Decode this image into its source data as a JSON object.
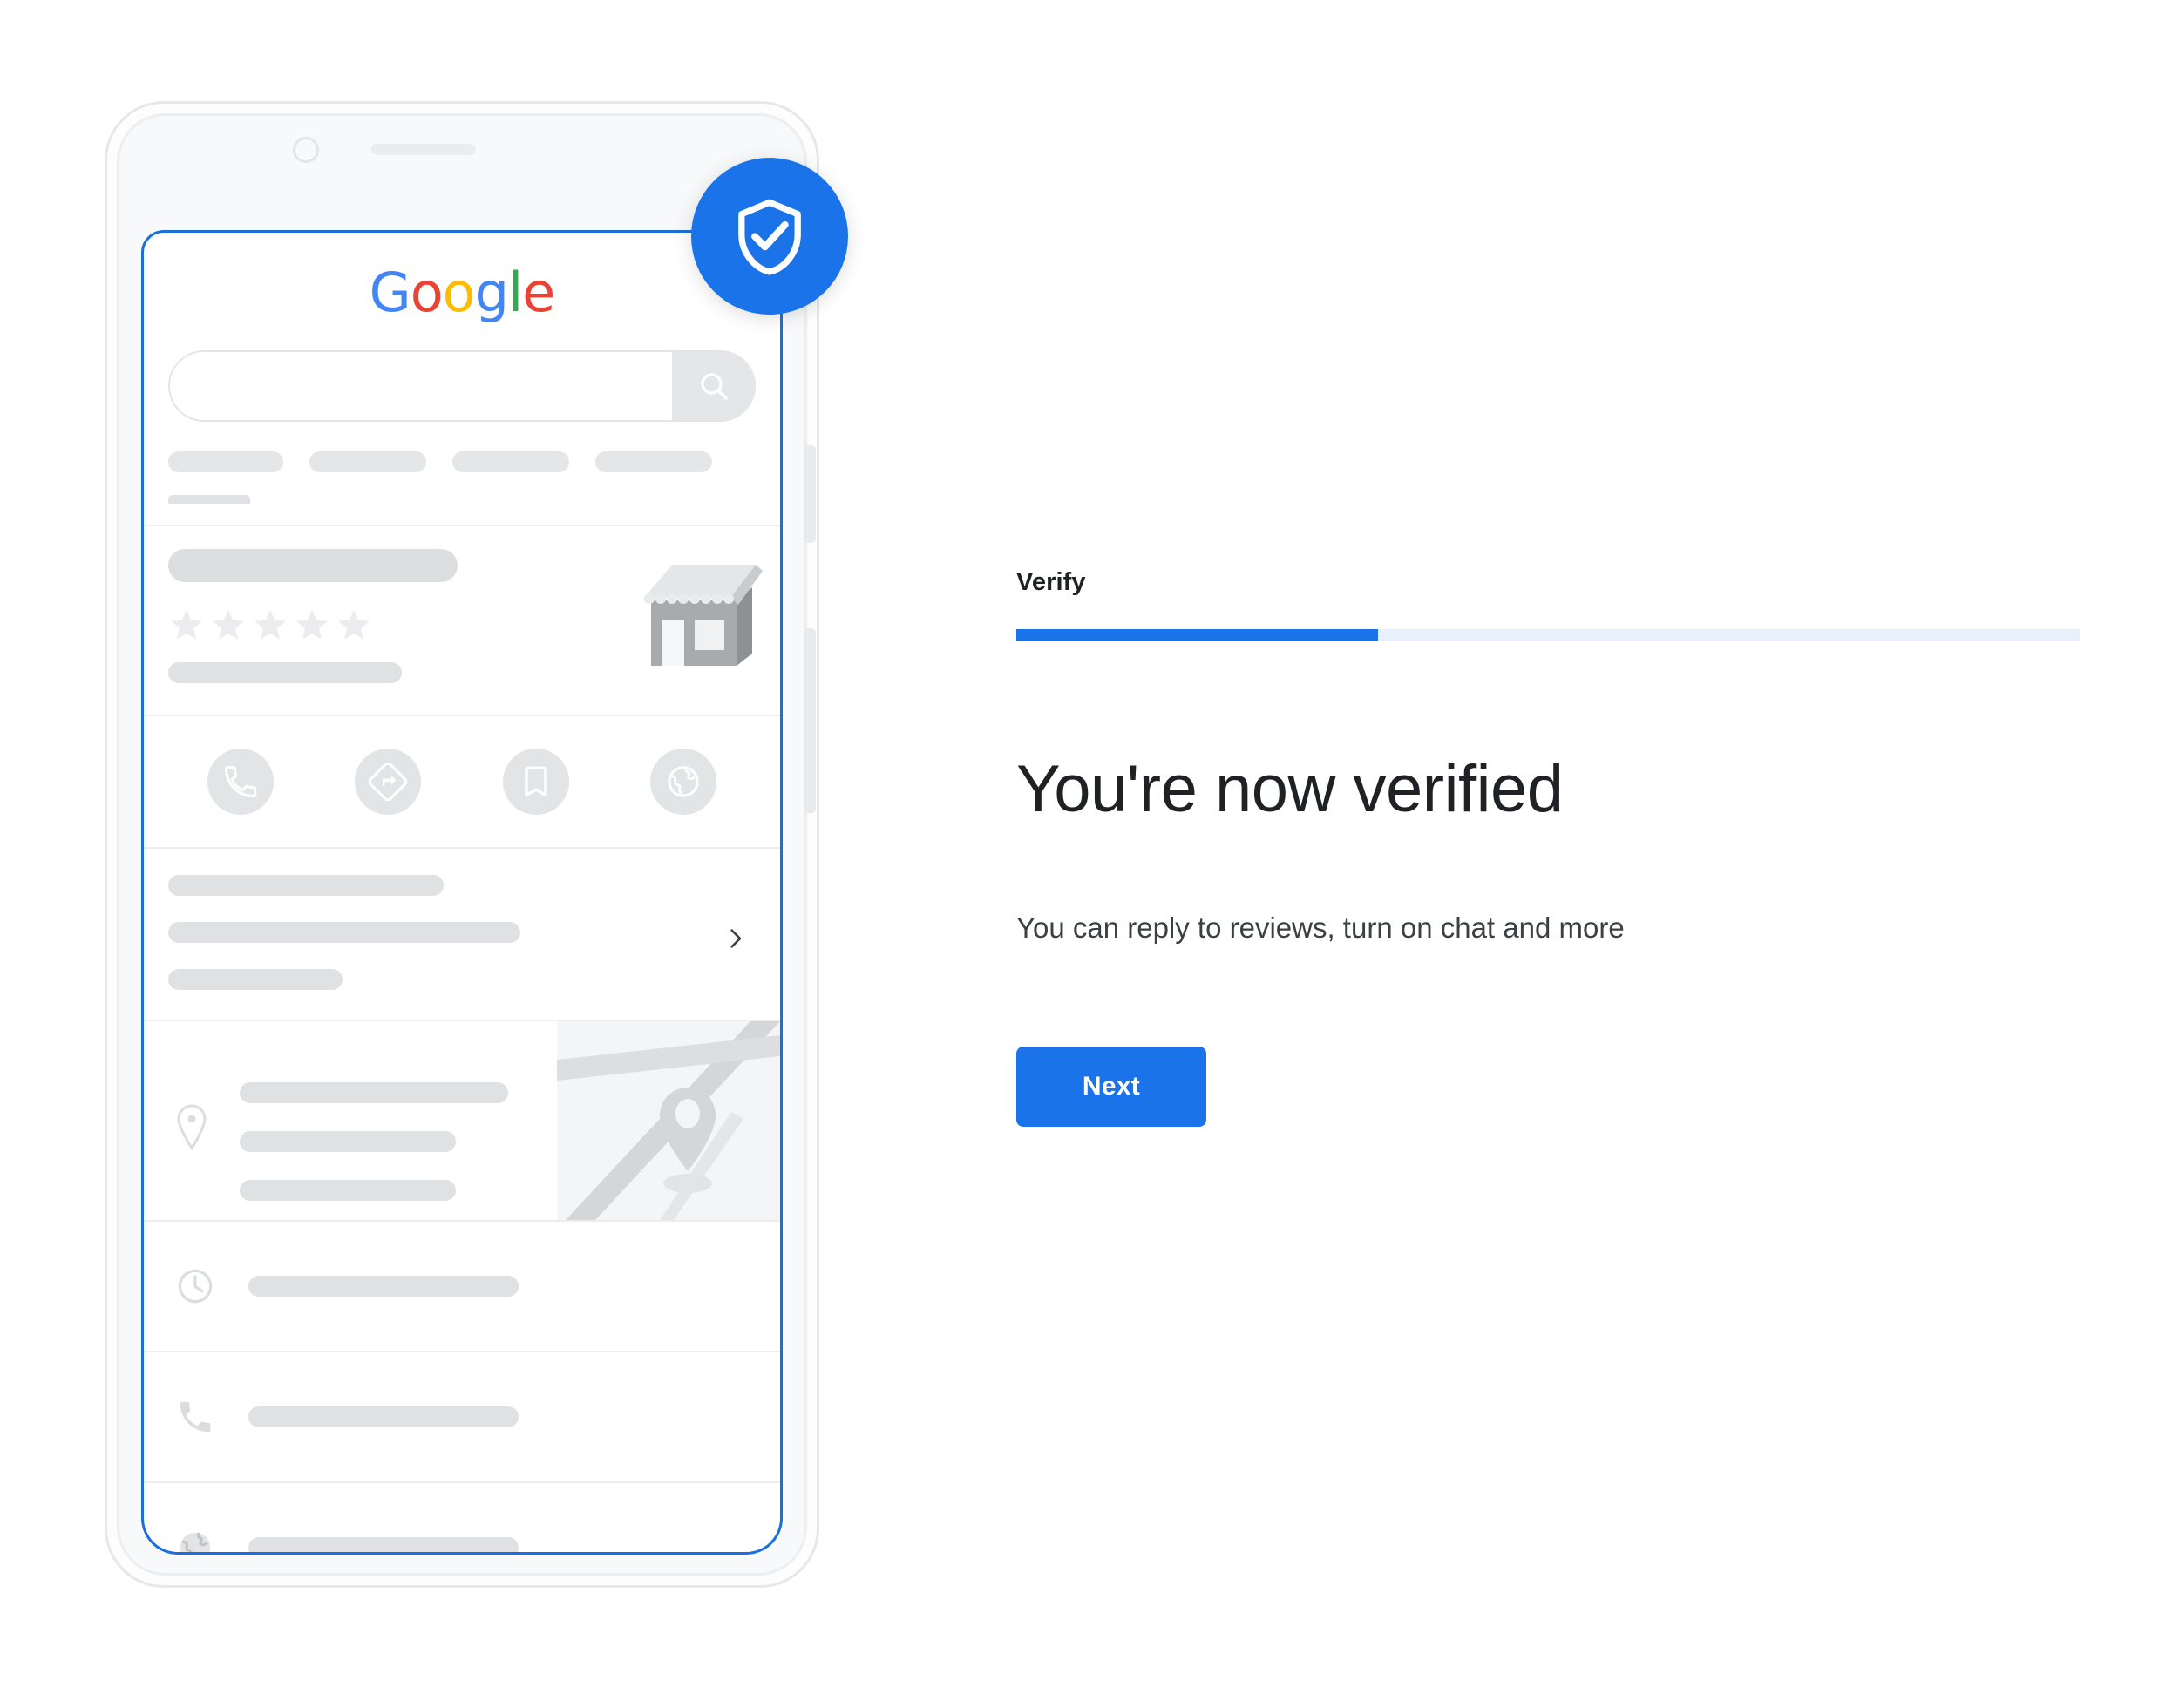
{
  "right_panel": {
    "step_label": "Verify",
    "progress_percent": 34,
    "headline": "You're now verified",
    "subheadline": "You can reply to reviews, turn on chat and more",
    "next_label": "Next"
  },
  "colors": {
    "accent_blue": "#1a73e8",
    "progress_track": "#e8f0fd",
    "text_primary": "#202124",
    "text_secondary": "#3c4043",
    "placeholder_grey": "#dfe1e3",
    "phone_frame": "#e6e8ea"
  },
  "badge": {
    "icon": "shield-check-icon"
  },
  "phone": {
    "hardware": {
      "camera": "front-camera",
      "speaker": "earpiece-speaker",
      "side_buttons": [
        "volume-button",
        "power-button"
      ]
    },
    "screen": {
      "logo": {
        "name": "google-logo",
        "letters": [
          {
            "char": "G",
            "color": "#4285f4"
          },
          {
            "char": "o",
            "color": "#ea4335"
          },
          {
            "char": "o",
            "color": "#fbbc05"
          },
          {
            "char": "g",
            "color": "#4285f4"
          },
          {
            "char": "l",
            "color": "#34a853"
          },
          {
            "char": "e",
            "color": "#ea4335"
          }
        ]
      },
      "search": {
        "value": "",
        "placeholder": "",
        "button_icon": "search-icon"
      },
      "nav_chips": [
        {
          "name": "nav-chip-1",
          "active": true
        },
        {
          "name": "nav-chip-2",
          "active": false
        },
        {
          "name": "nav-chip-3",
          "active": false
        },
        {
          "name": "nav-chip-4",
          "active": false
        }
      ],
      "business_card": {
        "title_placeholder": "",
        "rating_stars": 5,
        "subtitle_placeholder": "",
        "thumbnail": "storefront-illustration"
      },
      "action_buttons": [
        {
          "name": "call-action",
          "icon": "phone-icon"
        },
        {
          "name": "directions-action",
          "icon": "directions-icon"
        },
        {
          "name": "save-action",
          "icon": "bookmark-icon"
        },
        {
          "name": "website-action",
          "icon": "globe-icon"
        }
      ],
      "info_section": {
        "lines": 3,
        "chevron": "chevron-right-icon"
      },
      "address_section": {
        "icon": "location-pin-icon",
        "lines": 3,
        "map_thumbnail": "map-thumbnail",
        "map_marker": "map-pin-icon"
      },
      "detail_rows": [
        {
          "name": "hours-row",
          "icon": "clock-icon"
        },
        {
          "name": "phone-row",
          "icon": "phone-icon"
        },
        {
          "name": "website-row",
          "icon": "globe-icon"
        }
      ]
    }
  }
}
